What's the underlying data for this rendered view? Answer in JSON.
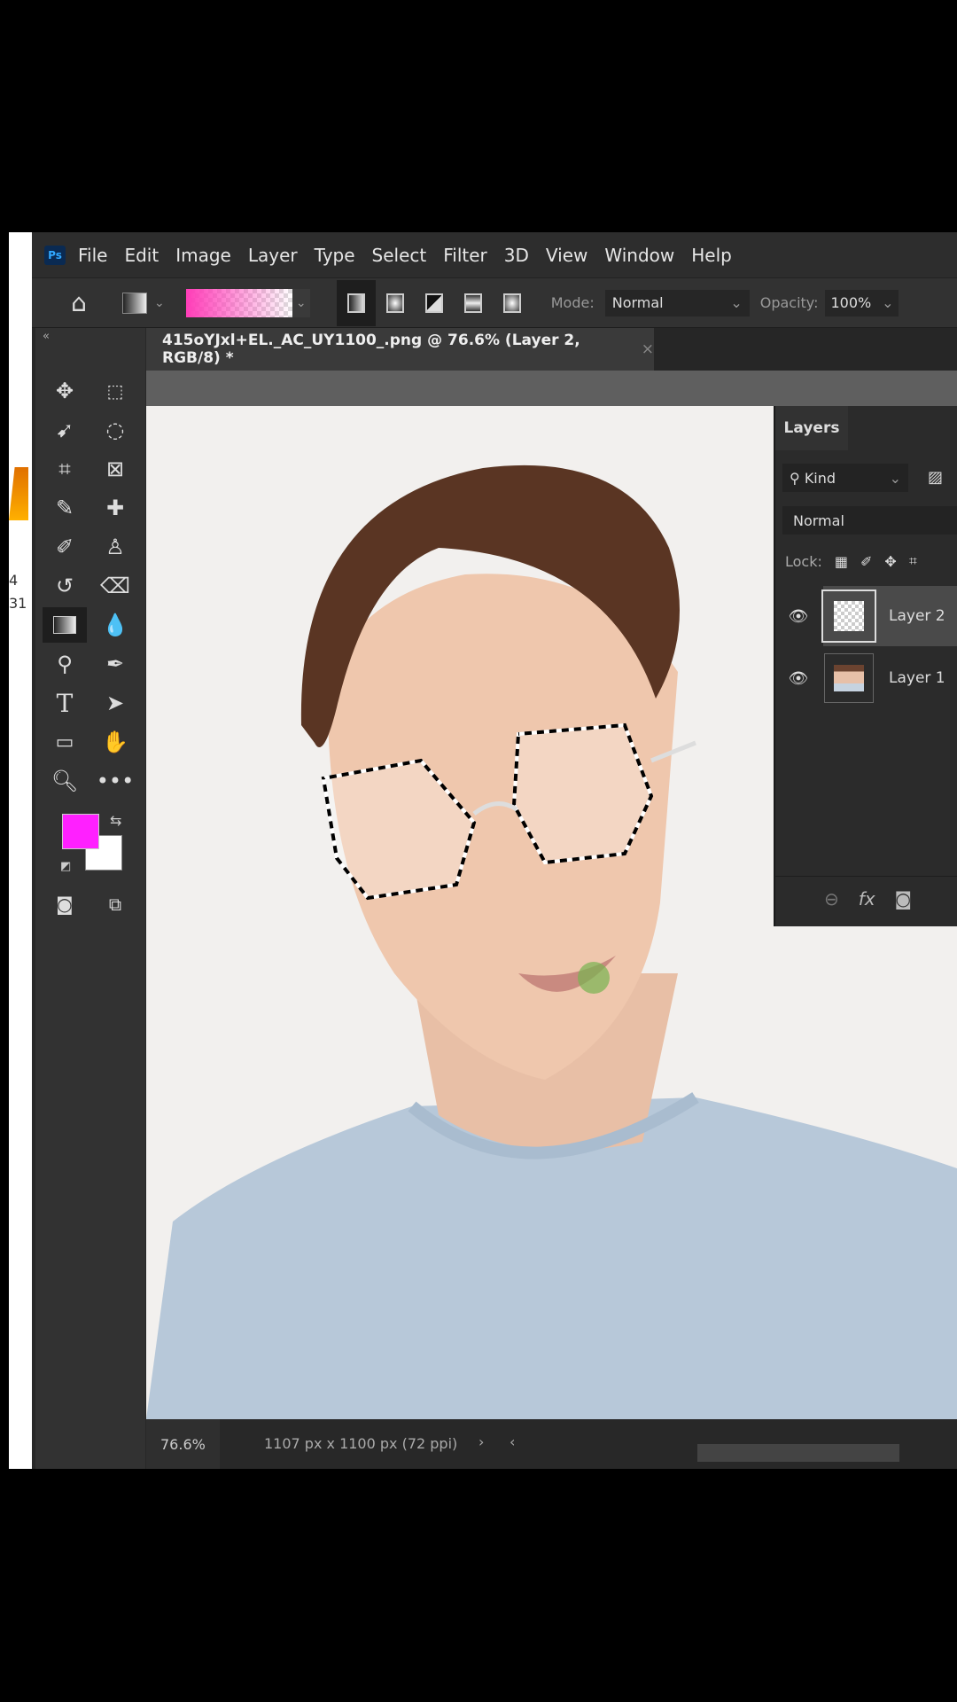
{
  "app": {
    "logo": "Ps"
  },
  "menu": [
    "File",
    "Edit",
    "Image",
    "Layer",
    "Type",
    "Select",
    "Filter",
    "3D",
    "View",
    "Window",
    "Help"
  ],
  "options": {
    "mode_label": "Mode:",
    "mode_value": "Normal",
    "opacity_label": "Opacity:",
    "opacity_value": "100%",
    "gradient_colors": [
      "#ff3db8",
      "transparent"
    ]
  },
  "document": {
    "tab_title": "415oYJxl+EL._AC_UY1100_.png @ 76.6% (Layer 2, RGB/8) *",
    "close": "×"
  },
  "toolbox": {
    "collapse": "«",
    "foreground_color": "#ff20ff",
    "background_color": "#ffffff"
  },
  "layers_panel": {
    "title": "Layers",
    "filter": "Kind",
    "blend_mode": "Normal",
    "lock_label": "Lock:",
    "layers": [
      {
        "name": "Layer 2",
        "selected": true,
        "visible": true
      },
      {
        "name": "Layer 1",
        "selected": false,
        "visible": true
      }
    ]
  },
  "status": {
    "zoom": "76.6%",
    "doc_info": "1107 px x 1100 px (72 ppi)",
    "next": "›",
    "prev": "‹"
  },
  "side_text": [
    "4",
    "31"
  ]
}
